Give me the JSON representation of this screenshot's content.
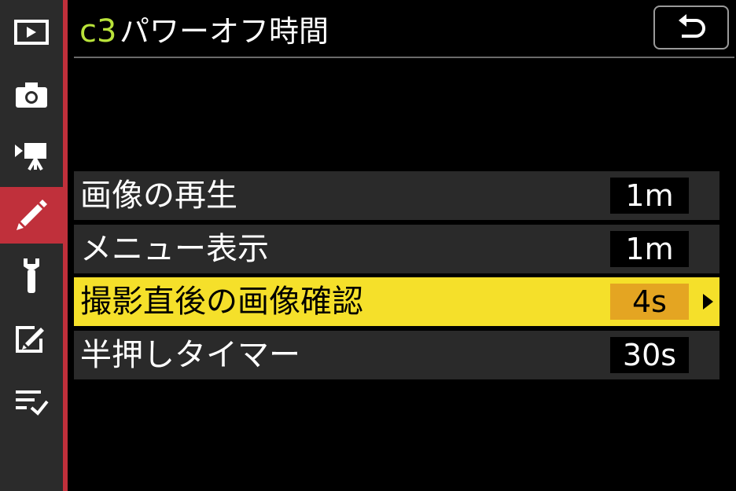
{
  "sidebar": {
    "items": [
      {
        "icon": "playback-icon"
      },
      {
        "icon": "camera-icon"
      },
      {
        "icon": "movie-camera-icon"
      },
      {
        "icon": "pencil-icon",
        "active": true
      },
      {
        "icon": "wrench-icon"
      },
      {
        "icon": "retouch-icon"
      },
      {
        "icon": "my-menu-icon"
      }
    ],
    "accent_color": "#c0303b"
  },
  "header": {
    "code": "c3",
    "title": "パワーオフ時間",
    "back_icon": "return-arrow-icon",
    "code_color": "#b9e33a"
  },
  "menu": {
    "items": [
      {
        "label": "画像の再生",
        "value": "1m"
      },
      {
        "label": "メニュー表示",
        "value": "1m"
      },
      {
        "label": "撮影直後の画像確認",
        "value": "4s",
        "selected": true
      },
      {
        "label": "半押しタイマー",
        "value": "30s"
      }
    ],
    "selected_color": "#f5e02a",
    "selected_value_color": "#e4a522"
  }
}
